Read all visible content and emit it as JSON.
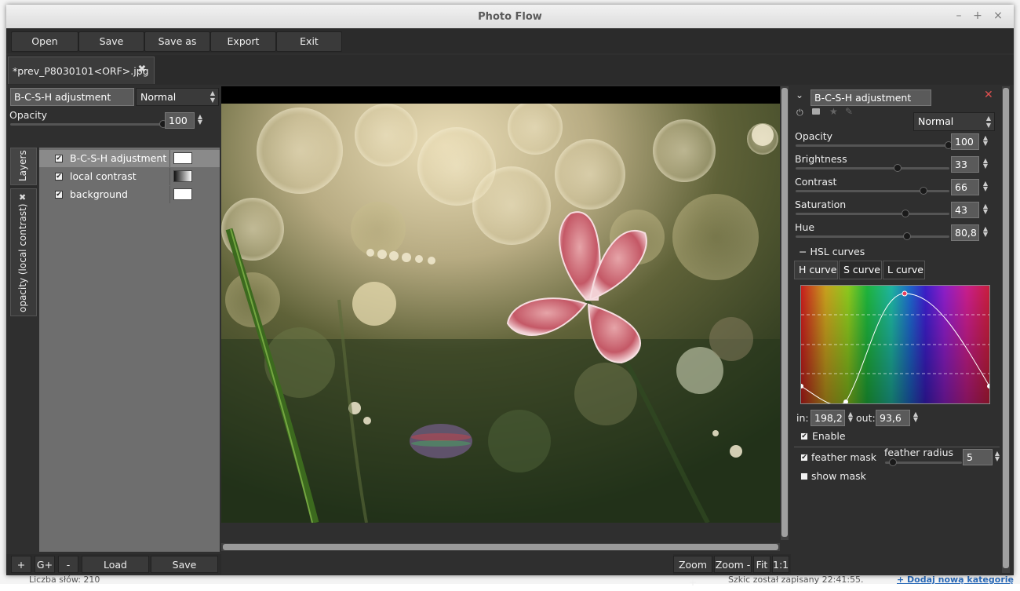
{
  "window": {
    "title": "Photo Flow"
  },
  "toolbar": {
    "open": "Open",
    "save": "Save",
    "save_as": "Save as",
    "export": "Export",
    "exit": "Exit"
  },
  "tab": {
    "label": "*prev_P8030101<ORF>.jpg"
  },
  "left": {
    "layer_name": "B-C-S-H adjustment",
    "blend_mode": "Normal",
    "opacity_label": "Opacity",
    "opacity_value": "100",
    "opacity_fraction": 1.0,
    "vtab_layers": "Layers",
    "vtab_mask": "opacity (local contrast)",
    "layers": [
      {
        "name": "B-C-S-H adjustment",
        "checked": true,
        "selected": true,
        "thumb": "white"
      },
      {
        "name": "local contrast",
        "checked": true,
        "selected": false,
        "thumb": "gradient"
      },
      {
        "name": "background",
        "checked": true,
        "selected": false,
        "thumb": "white"
      }
    ],
    "buttons": {
      "add": "+",
      "add_group": "G+",
      "remove": "-",
      "load": "Load",
      "save": "Save"
    }
  },
  "viewer": {
    "zoom_in": "Zoom +",
    "zoom_out": "Zoom -",
    "fit": "Fit",
    "one_to_one": "1:1"
  },
  "right": {
    "title": "B-C-S-H adjustment",
    "blend_mode": "Normal",
    "sliders": [
      {
        "label": "Opacity",
        "value": "100",
        "fraction": 1.0
      },
      {
        "label": "Brightness",
        "value": "33",
        "fraction": 0.66
      },
      {
        "label": "Contrast",
        "value": "66",
        "fraction": 0.83
      },
      {
        "label": "Saturation",
        "value": "43",
        "fraction": 0.71
      },
      {
        "label": "Hue",
        "value": "80,8",
        "fraction": 0.72
      }
    ],
    "hsl_header": "− HSL curves",
    "curve_tabs": [
      "H curve",
      "S curve",
      "L curve"
    ],
    "in_label": "in:",
    "in_value": "198,2",
    "out_label": "out:",
    "out_value": "93,6",
    "enable_label": "Enable",
    "feather_mask_label": "feather mask",
    "feather_radius_label": "feather radius",
    "feather_radius_value": "5",
    "show_mask_label": "show mask"
  },
  "desktop": {
    "status_left": "Liczba słów: 210",
    "status_mid": "Szkic został zapisany 22:41:55.",
    "status_link": "+ Dodaj nową kategorię"
  }
}
